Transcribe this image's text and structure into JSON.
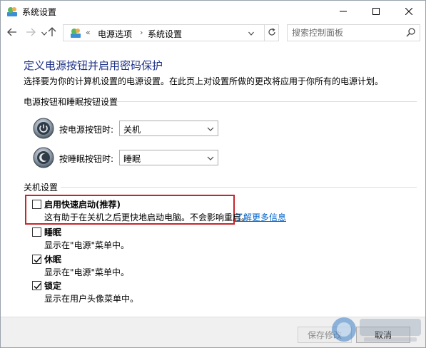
{
  "window": {
    "title": "系统设置",
    "icons": {
      "app": "control-panel-icon",
      "minimize": "minimize-icon",
      "maximize": "maximize-icon",
      "close": "close-icon"
    }
  },
  "nav": {
    "breadcrumb_chevron": "«",
    "breadcrumb": [
      "电源选项",
      "系统设置"
    ],
    "breadcrumb_separator": "›",
    "search_placeholder": "搜索控制面板",
    "icons": {
      "back": "back-arrow-icon",
      "forward": "forward-arrow-icon",
      "recent": "chevron-down-icon",
      "up": "up-arrow-icon",
      "refresh": "refresh-icon",
      "search": "search-icon"
    }
  },
  "page": {
    "title": "定义电源按钮并启用密码保护",
    "description": "选择要为你的计算机设置的电源设置。在此页上对设置所做的更改将应用于你所有的电源计划。"
  },
  "buttons_section": {
    "header": "电源按钮和睡眠按钮设置",
    "rows": [
      {
        "label": "按电源按钮时:",
        "value": "关机",
        "icon": "power-button-icon"
      },
      {
        "label": "按睡眠按钮时:",
        "value": "睡眠",
        "icon": "sleep-button-icon"
      }
    ]
  },
  "shutdown_section": {
    "header": "关机设置",
    "learn_more": "了解更多信息",
    "options": [
      {
        "label": "启用快速启动(推荐)",
        "description": "这有助于在关机之后更快地启动电脑。不会影响重启。",
        "checked": false,
        "highlighted": true
      },
      {
        "label": "睡眠",
        "description": "显示在\"电源\"菜单中。",
        "checked": false
      },
      {
        "label": "休眠",
        "description": "显示在\"电源\"菜单中。",
        "checked": true
      },
      {
        "label": "锁定",
        "description": "显示在用户头像菜单中。",
        "checked": true
      }
    ]
  },
  "footer": {
    "save_label": "保存修改",
    "cancel_label": "取消"
  },
  "colors": {
    "title_blue": "#1e3287",
    "link_blue": "#0066cc",
    "highlight_red": "#c9242b"
  }
}
